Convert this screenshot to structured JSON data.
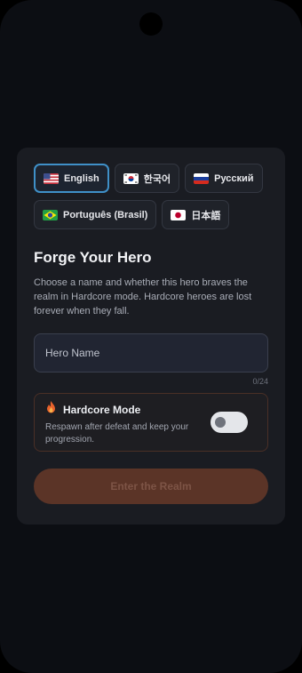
{
  "languages": [
    {
      "label": "English",
      "flag": "us-flag-icon",
      "selected": true
    },
    {
      "label": "한국어",
      "flag": "kr-flag-icon",
      "selected": false
    },
    {
      "label": "Русский",
      "flag": "ru-flag-icon",
      "selected": false
    },
    {
      "label": "Português (Brasil)",
      "flag": "br-flag-icon",
      "selected": false
    },
    {
      "label": "日本語",
      "flag": "jp-flag-icon",
      "selected": false
    }
  ],
  "form": {
    "title": "Forge Your Hero",
    "description": "Choose a name and whether this hero braves the realm in Hardcore mode. Hardcore heroes are lost forever when they fall.",
    "name_placeholder": "Hero Name",
    "name_counter": "0/24",
    "hardcore": {
      "title": "Hardcore Mode",
      "subtitle": "Respawn after defeat and keep your progression.",
      "icon": "flame-icon",
      "enabled": false
    },
    "submit_label": "Enter the Realm"
  },
  "colors": {
    "accent_selected": "#3f90c8",
    "cta_disabled": "#5b3427",
    "flame": "#e8622c"
  }
}
